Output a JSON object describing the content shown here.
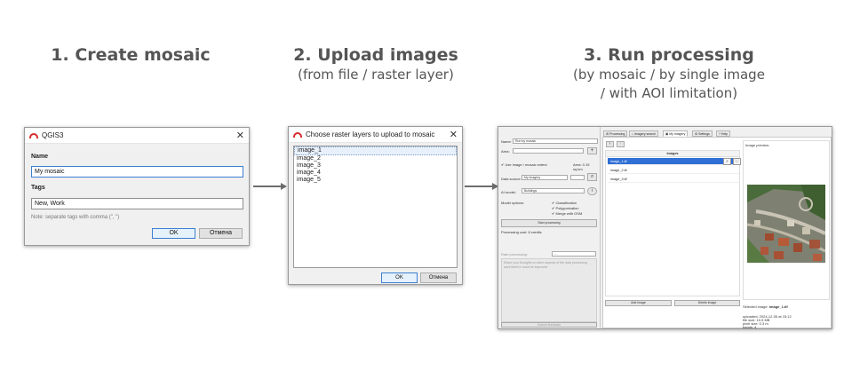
{
  "steps": [
    {
      "title": "1. Create mosaic",
      "subtitle": ""
    },
    {
      "title": "2. Upload images",
      "subtitle": "(from file / raster layer)"
    },
    {
      "title": "3. Run processing",
      "subtitle": "(by mosaic / by single image",
      "subtitle2": "/ with AOI limitation)"
    }
  ],
  "dialog1": {
    "title": "QGIS3",
    "name_label": "Name",
    "name_value": "My mosaic",
    "tags_label": "Tags",
    "tags_value": "New, Work",
    "note": "Note: separate tags with comma (\", \")",
    "ok": "OK",
    "cancel": "Отмена"
  },
  "dialog2": {
    "title": "Choose raster layers to upload to mosaic",
    "layers": [
      "image_1",
      "image_2",
      "image_3",
      "image_4",
      "image_5"
    ],
    "ok": "OK",
    "cancel": "Отмена"
  },
  "plugin": {
    "left": {
      "name_label": "Name:",
      "name_value": "Run by mosaic",
      "area_label": "Area:",
      "use_extent": "Use image / mosaic extent",
      "area_value": "Area: 0.15 sq.km",
      "data_source_label": "Data source:",
      "data_source_value": "My imagery",
      "ai_model_label": "AI model:",
      "ai_model_value": "Buildings",
      "model_options_label": "Model options:",
      "options": [
        "Classification",
        "Polygonization",
        "Merge with OSM"
      ],
      "start_button": "Start processing",
      "cost": "Processing cost: 8 credits",
      "rate_label": "Rate processing:",
      "rate_value": "---",
      "feedback_placeholder": "Share your thoughts on other aspects of the data processing work itself or could be improved",
      "submit": "Submit feedback"
    },
    "tabs": [
      "Processing",
      "Imagery search",
      "My imagery",
      "Settings",
      "Help"
    ],
    "images_header": "Images",
    "images": [
      "image_1.tif",
      "image_2.tif",
      "image_3.tif"
    ],
    "add_image": "Add image",
    "delete_image": "Delete image",
    "preview_label": "Image preview:",
    "selected_label": "Selected image: ",
    "selected_value": "image_1.tif",
    "meta": [
      "uploaded: 2024-12-05 at 15:12",
      "file size: 10.5 MB",
      "pixel size: 0.3 m",
      "bands: 4"
    ]
  }
}
